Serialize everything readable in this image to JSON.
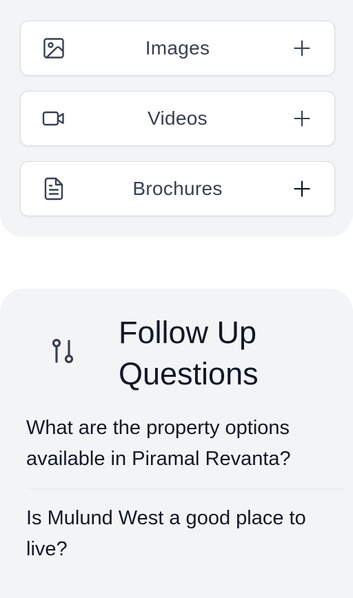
{
  "media": {
    "items": [
      {
        "label": "Images",
        "icon": "image-icon"
      },
      {
        "label": "Videos",
        "icon": "video-icon"
      },
      {
        "label": "Brochures",
        "icon": "document-icon"
      }
    ]
  },
  "follow_up": {
    "title_line1": "Follow Up",
    "title_line2": "Questions",
    "questions": [
      "What are the property options available in Piramal Revanta?",
      "Is Mulund West a good place to live?"
    ]
  },
  "colors": {
    "card_bg": "#f3f4f6",
    "border": "#d8dbe0",
    "text": "#111827",
    "label": "#374151"
  }
}
